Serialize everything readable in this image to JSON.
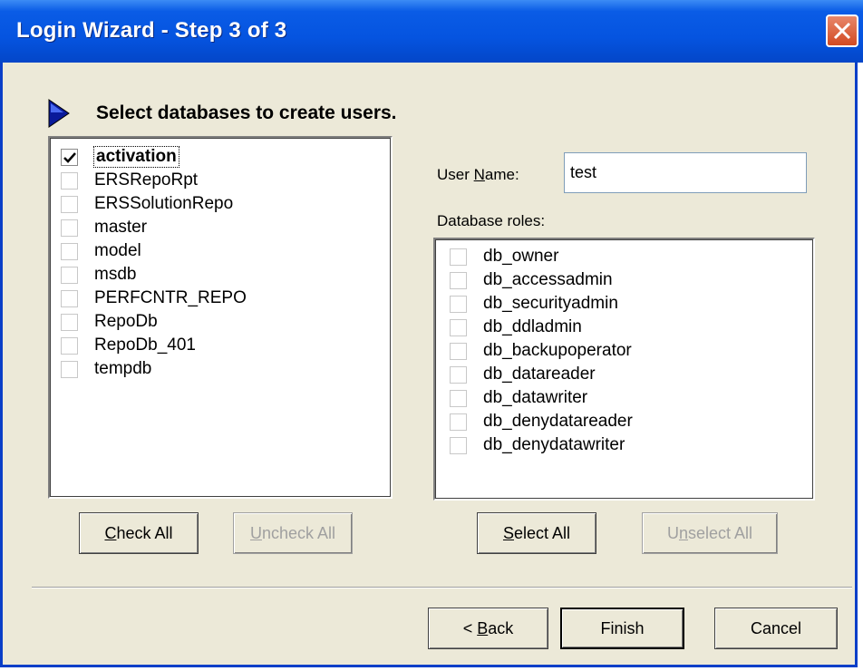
{
  "window": {
    "title": "Login Wizard - Step 3 of 3"
  },
  "instruction": "Select databases to create users.",
  "databases": [
    {
      "label": "activation",
      "checked": true,
      "focused": true
    },
    {
      "label": "ERSRepoRpt",
      "checked": false
    },
    {
      "label": "ERSSolutionRepo",
      "checked": false
    },
    {
      "label": "master",
      "checked": false
    },
    {
      "label": "model",
      "checked": false
    },
    {
      "label": "msdb",
      "checked": false
    },
    {
      "label": "PERFCNTR_REPO",
      "checked": false
    },
    {
      "label": "RepoDb",
      "checked": false
    },
    {
      "label": "RepoDb_401",
      "checked": false
    },
    {
      "label": "tempdb",
      "checked": false
    }
  ],
  "user_name": {
    "label": "User Name:",
    "value": "test"
  },
  "roles_label": "Database roles:",
  "roles": [
    {
      "label": "db_owner",
      "checked": false
    },
    {
      "label": "db_accessadmin",
      "checked": false
    },
    {
      "label": "db_securityadmin",
      "checked": false
    },
    {
      "label": "db_ddladmin",
      "checked": false
    },
    {
      "label": "db_backupoperator",
      "checked": false
    },
    {
      "label": "db_datareader",
      "checked": false
    },
    {
      "label": "db_datawriter",
      "checked": false
    },
    {
      "label": "db_denydatareader",
      "checked": false
    },
    {
      "label": "db_denydatawriter",
      "checked": false
    }
  ],
  "buttons": {
    "check_all": "Check All",
    "uncheck_all": "Uncheck All",
    "select_all": "Select All",
    "unselect_all": "Unselect All",
    "back": "< Back",
    "finish": "Finish",
    "cancel": "Cancel"
  },
  "colors": {
    "titlebar": "#0554e0",
    "client": "#ece9d8",
    "close": "#d24a22"
  }
}
